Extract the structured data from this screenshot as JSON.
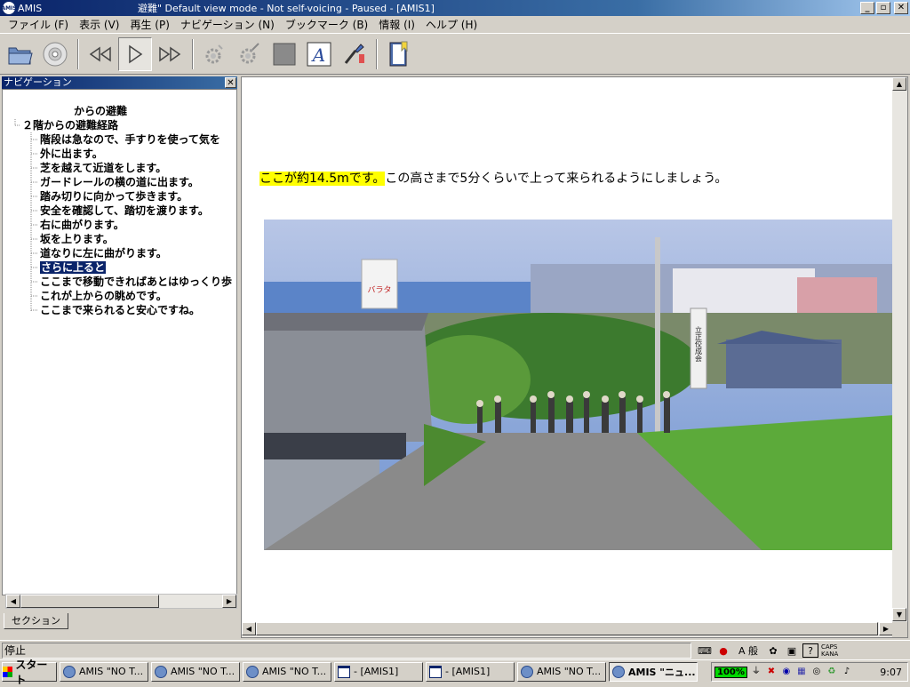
{
  "window": {
    "app_name": "AMIS",
    "title": "避難\" Default view mode - Not self-voicing - Paused - [AMIS1]",
    "minimize": "_",
    "maximize": "▫",
    "close": "✕"
  },
  "menu": [
    "ファイル (F)",
    "表示 (V)",
    "再生 (P)",
    "ナビゲーション (N)",
    "ブックマーク (B)",
    "情報 (I)",
    "ヘルプ (H)"
  ],
  "navigation": {
    "header": "ナビゲーション",
    "close": "✕",
    "tree": [
      {
        "label": "からの避難",
        "level": 0,
        "selected": false
      },
      {
        "label": "２階からの避難経路",
        "level": 1,
        "selected": false
      },
      {
        "label": "階段は急なので、手すりを使って気を",
        "level": 2,
        "selected": false
      },
      {
        "label": "外に出ます。",
        "level": 2,
        "selected": false
      },
      {
        "label": "芝を越えて近道をします。",
        "level": 2,
        "selected": false
      },
      {
        "label": "ガードレールの横の道に出ます。",
        "level": 2,
        "selected": false
      },
      {
        "label": "踏み切りに向かって歩きます。",
        "level": 2,
        "selected": false
      },
      {
        "label": "安全を確認して、踏切を渡ります。",
        "level": 2,
        "selected": false
      },
      {
        "label": "右に曲がります。",
        "level": 2,
        "selected": false
      },
      {
        "label": "坂を上ります。",
        "level": 2,
        "selected": false
      },
      {
        "label": "道なりに左に曲がります。",
        "level": 2,
        "selected": false
      },
      {
        "label": "さらに上ると",
        "level": 2,
        "selected": true
      },
      {
        "label": "ここまで移動できればあとはゆっくり歩",
        "level": 2,
        "selected": false
      },
      {
        "label": "これが上からの眺めです。",
        "level": 2,
        "selected": false
      },
      {
        "label": "ここまで来られると安心ですね。",
        "level": 2,
        "selected": false
      }
    ],
    "tab": "セクション"
  },
  "content": {
    "highlighted": "ここが約14.5mです。",
    "rest": "この高さまで5分くらいで上って来られるようにしましょう。",
    "photo_sign": "バラタ",
    "photo_sign2": "立正佼成会"
  },
  "status": {
    "text": "停止",
    "ime_mode": "A 般",
    "caps": "CAPS",
    "kana": "KANA"
  },
  "taskbar": {
    "start": "スタート",
    "tasks": [
      {
        "label": "AMIS \"NO T...",
        "icon": "amis-icon",
        "active": false
      },
      {
        "label": "AMIS \"NO T...",
        "icon": "amis-icon",
        "active": false
      },
      {
        "label": "AMIS \"NO T...",
        "icon": "amis-icon",
        "active": false
      },
      {
        "label": "- [AMIS1]",
        "icon": "window-icon",
        "active": false
      },
      {
        "label": "- [AMIS1]",
        "icon": "window-icon",
        "active": false
      },
      {
        "label": "AMIS \"NO T...",
        "icon": "amis-icon",
        "active": false
      },
      {
        "label": "AMIS \"ニュ...",
        "icon": "amis-icon",
        "active": true
      }
    ],
    "battery": "100%",
    "clock": "9:07"
  },
  "colors": {
    "highlight": "#ffff00",
    "selection": "#0a246a",
    "titlebar": "#0a246a"
  }
}
